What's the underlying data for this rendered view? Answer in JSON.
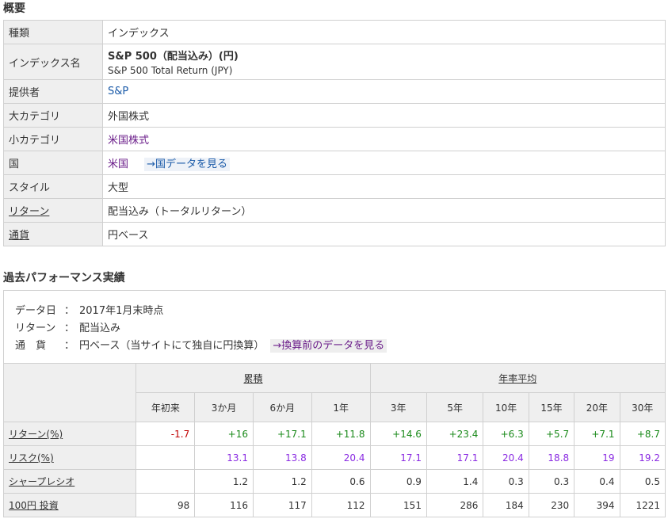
{
  "overview": {
    "heading": "概要",
    "rows": [
      {
        "key": "種類",
        "value": "インデックス"
      },
      {
        "key": "インデックス名",
        "value": "S&P 500（配当込み）(円)",
        "value2": "S&P 500 Total Return (JPY)"
      },
      {
        "key": "提供者",
        "value": "S&P"
      },
      {
        "key": "大カテゴリ",
        "value": "外国株式"
      },
      {
        "key": "小カテゴリ",
        "value": "米国株式"
      },
      {
        "key": "国",
        "value": "米国",
        "link": "→国データを見る"
      },
      {
        "key": "スタイル",
        "value": "大型"
      },
      {
        "key": "リターン",
        "value": "配当込み（トータルリターン）"
      },
      {
        "key": "通貨",
        "value": "円ベース"
      }
    ]
  },
  "performance": {
    "heading": "過去パフォーマンス実績",
    "info": [
      {
        "label": "データ日",
        "sep": "：",
        "value": "2017年1月末時点"
      },
      {
        "label": "リターン",
        "sep": "：",
        "value": "配当込み"
      },
      {
        "label": "通　貨",
        "sep": "：",
        "value": "円ベース（当サイトにて独自に円換算）",
        "link": "→換算前のデータを見る"
      }
    ],
    "group_headers": {
      "cumulative": "累積",
      "annualized": "年率平均"
    },
    "columns": [
      "年初来",
      "3か月",
      "6か月",
      "1年",
      "3年",
      "5年",
      "10年",
      "15年",
      "20年",
      "30年"
    ],
    "rows": [
      {
        "label": "リターン(%)",
        "values": [
          "-1.7",
          "+16",
          "+17.1",
          "+11.8",
          "+14.6",
          "+23.4",
          "+6.3",
          "+5.7",
          "+7.1",
          "+8.7"
        ]
      },
      {
        "label": "リスク(%)",
        "values": [
          "",
          "13.1",
          "13.8",
          "20.4",
          "17.1",
          "17.1",
          "20.4",
          "18.8",
          "19",
          "19.2"
        ]
      },
      {
        "label": "シャープレシオ",
        "values": [
          "",
          "1.2",
          "1.2",
          "0.6",
          "0.9",
          "1.4",
          "0.3",
          "0.3",
          "0.4",
          "0.5"
        ]
      },
      {
        "label": "100円 投資",
        "values": [
          "98",
          "116",
          "117",
          "112",
          "151",
          "286",
          "184",
          "230",
          "394",
          "1221"
        ]
      }
    ]
  }
}
